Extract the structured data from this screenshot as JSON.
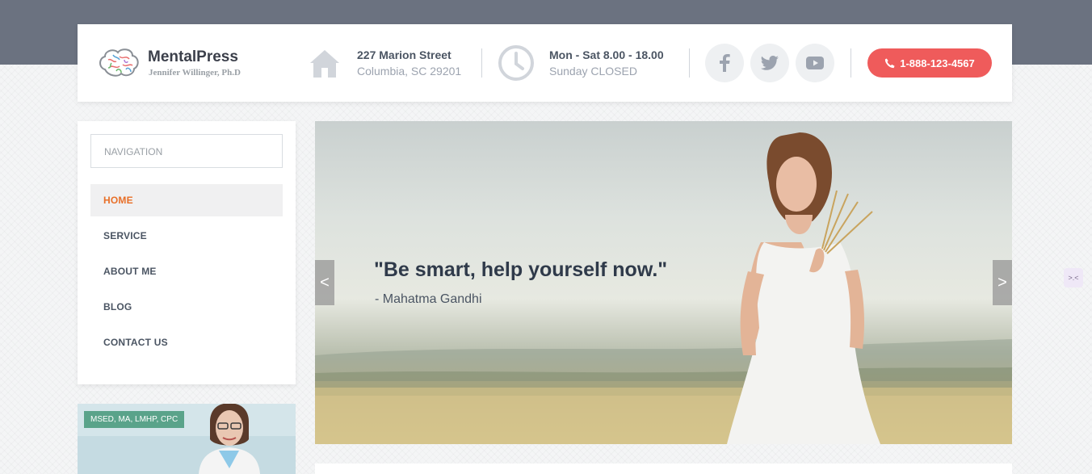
{
  "header": {
    "brand_name": "MentalPress",
    "brand_tagline": "Jennifer Willinger, Ph.D",
    "address": {
      "line1": "227 Marion Street",
      "line2": "Columbia, SC 29201",
      "icon": "home-icon"
    },
    "hours": {
      "line1": "Mon - Sat 8.00 - 18.00",
      "line2": "Sunday CLOSED",
      "icon": "clock-icon"
    },
    "social": [
      {
        "name": "facebook",
        "label": "f"
      },
      {
        "name": "twitter",
        "label": "twitter"
      },
      {
        "name": "youtube",
        "label": "youtube"
      }
    ],
    "phone": "1-888-123-4567"
  },
  "sidebar": {
    "nav_title": "NAVIGATION",
    "items": [
      {
        "label": "HOME",
        "active": true
      },
      {
        "label": "SERVICE",
        "active": false
      },
      {
        "label": "ABOUT ME",
        "active": false
      },
      {
        "label": "BLOG",
        "active": false
      },
      {
        "label": "CONTACT US",
        "active": false
      }
    ]
  },
  "profile": {
    "badge": "MSED, MA, LMHP, CPC"
  },
  "slider": {
    "quote": "\"Be smart, help yourself now.\"",
    "author": "- Mahatma Gandhi",
    "prev": "<",
    "next": ">"
  },
  "colors": {
    "accent": "#ef5b5b",
    "active_nav": "#e86f28",
    "badge": "#5aa38a",
    "top_band": "#6b7280"
  }
}
